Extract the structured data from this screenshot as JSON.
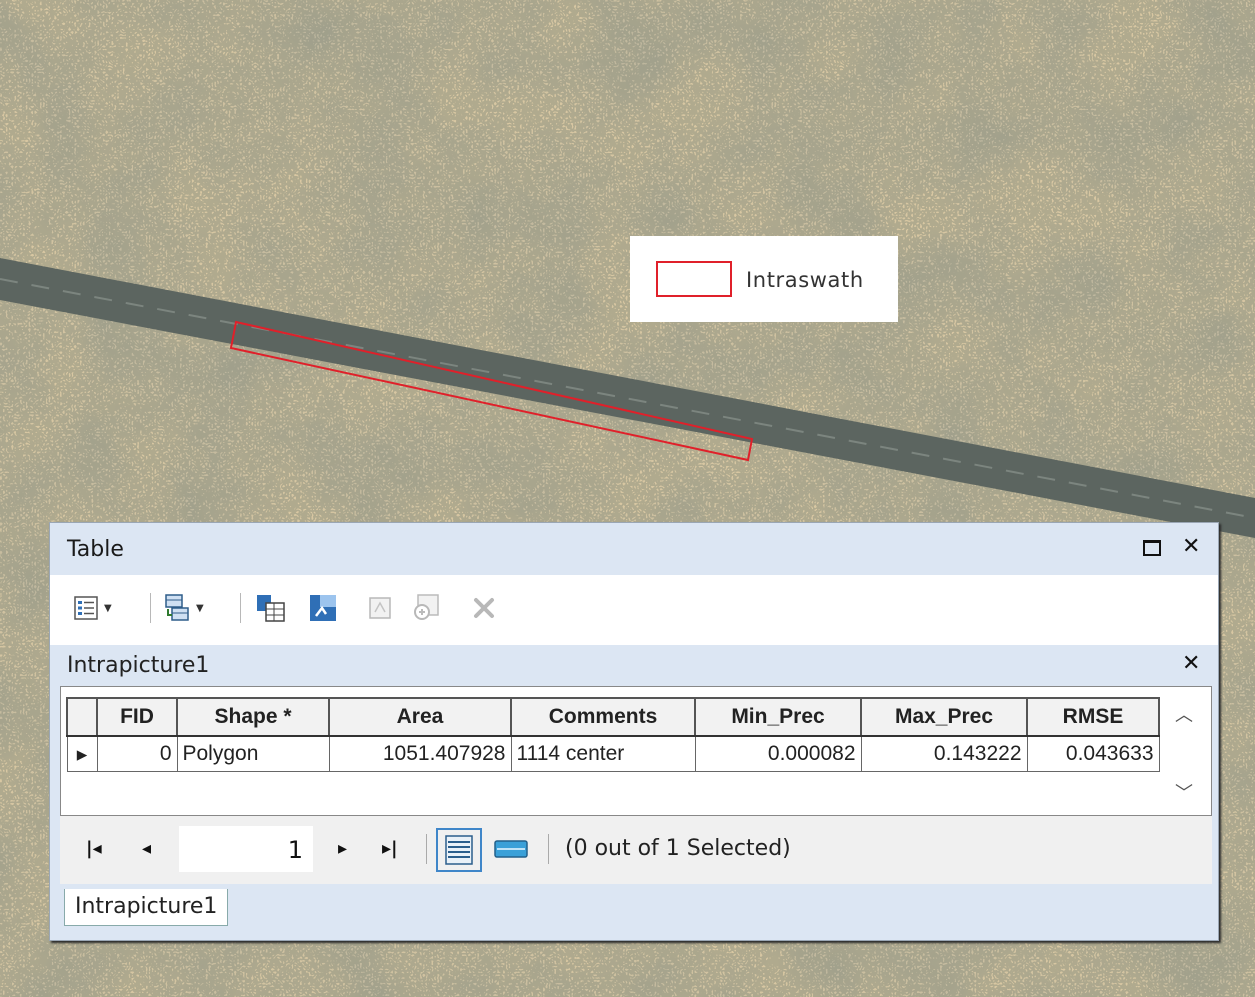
{
  "legend": {
    "label": "Intraswath",
    "swatch_color": "#e0202a"
  },
  "window": {
    "title": "Table",
    "maximize_icon": "maximize-icon",
    "close_glyph": "✕"
  },
  "toolbar": {
    "icons": [
      "table-options-icon",
      "related-tables-icon",
      "select-by-attributes-icon",
      "switch-selection-icon",
      "clear-selection-icon",
      "zoom-to-selected-icon",
      "delete-selected-icon"
    ]
  },
  "table_tab": {
    "title": "Intrapicture1",
    "close_glyph": "✕"
  },
  "grid": {
    "columns": [
      "FID",
      "Shape *",
      "Area",
      "Comments",
      "Min_Prec",
      "Max_Prec",
      "RMSE"
    ],
    "rows": [
      {
        "fid": "0",
        "shape": "Polygon",
        "area": "1051.407928",
        "comments": "1114 center",
        "min_prec": "0.000082",
        "max_prec": "0.143222",
        "rmse": "0.043633"
      }
    ]
  },
  "nav": {
    "page": "1",
    "selection_text": "(0 out of 1 Selected)"
  },
  "bottom_tab": {
    "label": "Intrapicture1"
  }
}
